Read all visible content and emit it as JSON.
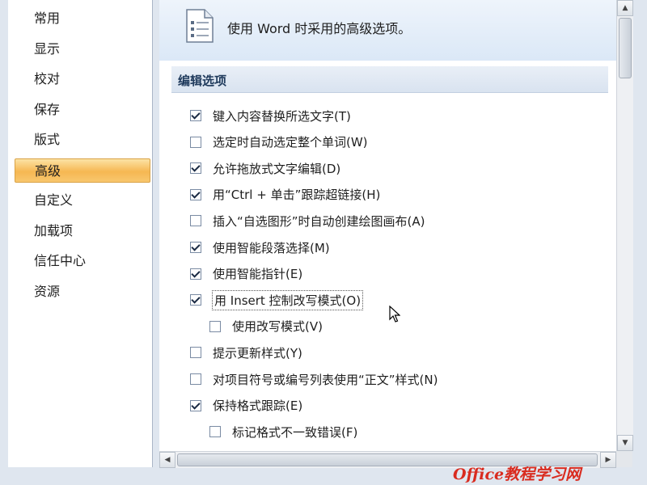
{
  "nav": {
    "items": [
      {
        "label": "常用"
      },
      {
        "label": "显示"
      },
      {
        "label": "校对"
      },
      {
        "label": "保存"
      },
      {
        "label": "版式"
      },
      {
        "label": "高级",
        "selected": true
      },
      {
        "label": "自定义"
      },
      {
        "label": "加载项"
      },
      {
        "label": "信任中心"
      },
      {
        "label": "资源"
      }
    ]
  },
  "header": {
    "title": "使用 Word 时采用的高级选项。",
    "icon": "document-options-icon"
  },
  "section": {
    "title": "编辑选项"
  },
  "options": [
    {
      "label": "键入内容替换所选文字(T)",
      "checked": true
    },
    {
      "label": "选定时自动选定整个单词(W)",
      "checked": false
    },
    {
      "label": "允许拖放式文字编辑(D)",
      "checked": true
    },
    {
      "label": "用“Ctrl + 单击”跟踪超链接(H)",
      "checked": true
    },
    {
      "label": "插入“自选图形”时自动创建绘图画布(A)",
      "checked": false
    },
    {
      "label": "使用智能段落选择(M)",
      "checked": true
    },
    {
      "label": "使用智能指针(E)",
      "checked": true
    },
    {
      "label": "用 Insert 控制改写模式(O)",
      "checked": true,
      "focused": true
    },
    {
      "label": "使用改写模式(V)",
      "checked": false,
      "indent": true
    },
    {
      "label": "提示更新样式(Y)",
      "checked": false
    },
    {
      "label": "对项目符号或编号列表使用“正文”样式(N)",
      "checked": false
    },
    {
      "label": "保持格式跟踪(E)",
      "checked": true
    },
    {
      "label": "标记格式不一致错误(F)",
      "checked": false,
      "indent": true
    }
  ],
  "watermark": "Office教程学习网",
  "colors": {
    "selected_nav": "#f6b752",
    "header_bg": "#dbe8f7",
    "watermark": "#d92b1f"
  }
}
